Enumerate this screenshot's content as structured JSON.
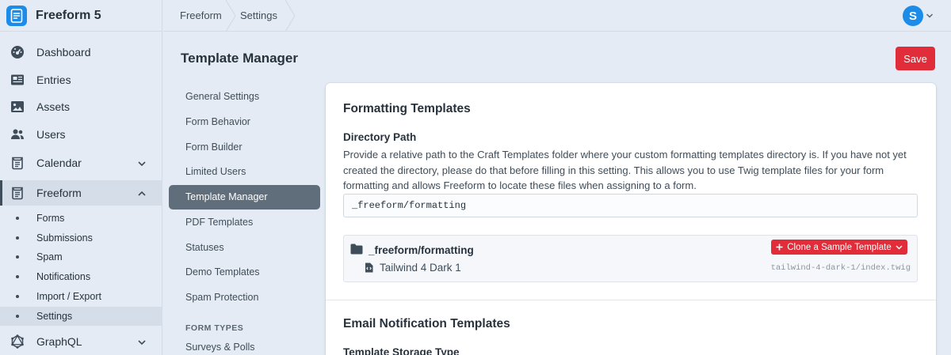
{
  "app": {
    "name": "Freeform 5"
  },
  "sidebar": {
    "items": [
      {
        "label": "Dashboard",
        "icon": "gauge-icon"
      },
      {
        "label": "Entries",
        "icon": "newspaper-icon"
      },
      {
        "label": "Assets",
        "icon": "image-icon"
      },
      {
        "label": "Users",
        "icon": "users-icon"
      },
      {
        "label": "Calendar",
        "icon": "calendar-icon"
      },
      {
        "label": "Freeform",
        "icon": "freeform-icon"
      },
      {
        "label": "GraphQL",
        "icon": "graphql-icon"
      }
    ],
    "sub_items": [
      "Forms",
      "Submissions",
      "Spam",
      "Notifications",
      "Import / Export",
      "Settings"
    ]
  },
  "breadcrumbs": [
    "Freeform",
    "Settings"
  ],
  "user": {
    "initial": "S"
  },
  "page": {
    "title": "Template Manager",
    "save_label": "Save"
  },
  "settings_nav": {
    "items": [
      "General Settings",
      "Form Behavior",
      "Form Builder",
      "Limited Users",
      "Template Manager",
      "PDF Templates",
      "Statuses",
      "Demo Templates",
      "Spam Protection"
    ],
    "heading": "FORM TYPES",
    "type_items": [
      "Surveys & Polls"
    ]
  },
  "formatting": {
    "title": "Formatting Templates",
    "dir_label": "Directory Path",
    "dir_desc": "Provide a relative path to the Craft Templates folder where your custom formatting templates directory is. If you have not yet created the directory, please do that before filling in this setting. This allows you to use Twig template files for your form formatting and allows Freeform to locate these files when assigning to a form.",
    "dir_value": "_freeform/formatting",
    "folder_name": "_freeform/formatting",
    "clone_label": "Clone a Sample Template",
    "file_name": "Tailwind 4 Dark 1",
    "file_path": "tailwind-4-dark-1/index.twig"
  },
  "email": {
    "title": "Email Notification Templates",
    "storage_label": "Template Storage Type"
  },
  "colors": {
    "accent": "#e12d39",
    "brand": "#1c8ce8",
    "sidebar_bg": "#e4ebf4"
  }
}
